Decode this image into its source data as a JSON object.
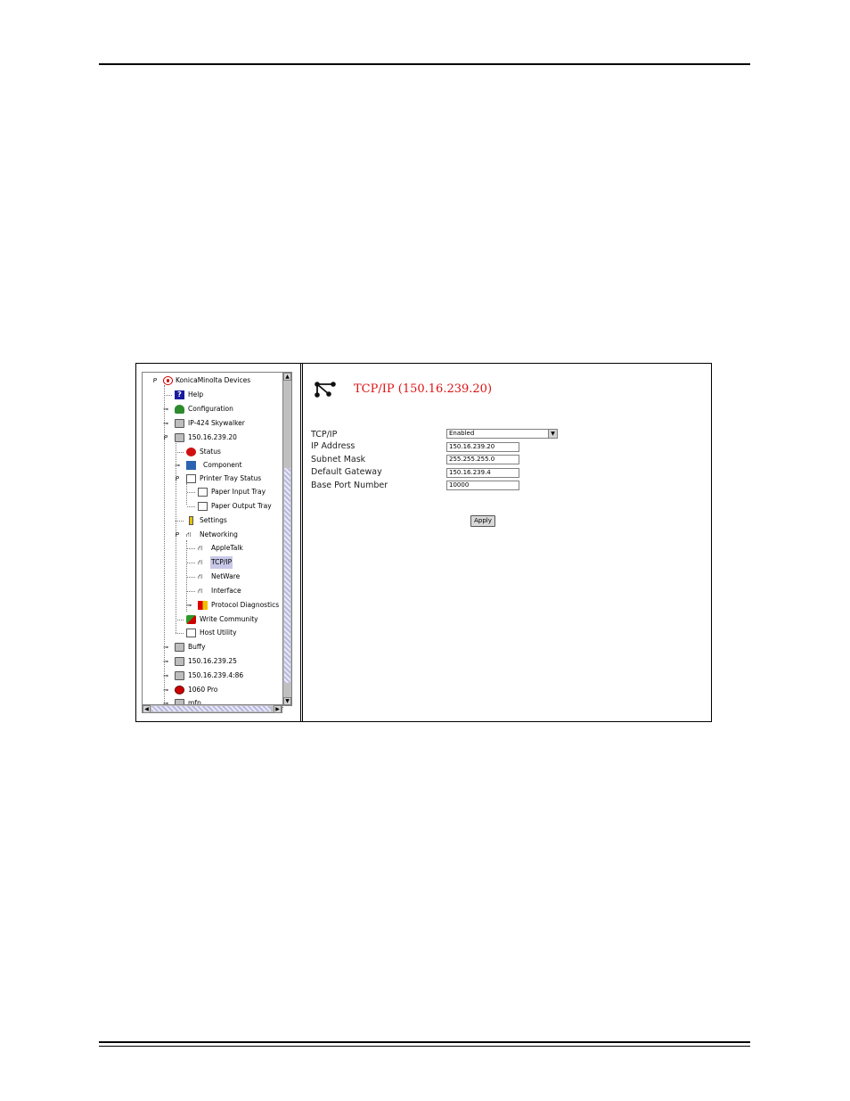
{
  "tree": {
    "root": "KonicaMinolta Devices",
    "items": {
      "help": "Help",
      "configuration": "Configuration",
      "ip424": "IP-424 Skywalker",
      "dev20": "150.16.239.20",
      "status": "Status",
      "component": "Component",
      "tray_status": "Printer Tray Status",
      "paper_input": "Paper Input Tray",
      "paper_output": "Paper Output Tray",
      "settings": "Settings",
      "networking": "Networking",
      "appletalk": "AppleTalk",
      "tcpip": "TCP/IP",
      "netware": "NetWare",
      "interface": "Interface",
      "protocol_diag": "Protocol Diagnostics",
      "write_community": "Write Community",
      "host_utility": "Host Utility",
      "buffy": "Buffy",
      "dev25": "150.16.239.25",
      "dev486": "150.16.239.4:86",
      "pro1060": "1060 Pro",
      "mfp": "mfp"
    }
  },
  "panel": {
    "title": "TCP/IP (150.16.239.20)",
    "fields": {
      "tcpip_label": "TCP/IP",
      "tcpip_value": "Enabled",
      "ip_label": "IP Address",
      "ip_value": "150.16.239.20",
      "mask_label": "Subnet Mask",
      "mask_value": "255.255.255.0",
      "gateway_label": "Default Gateway",
      "gateway_value": "150.16.239.4",
      "port_label": "Base Port Number",
      "port_value": "10000"
    },
    "apply_label": "Apply"
  },
  "icons": [
    "network-icon",
    "printer-icon",
    "help-icon",
    "eye-icon"
  ],
  "colors": {
    "title": "#dd1111",
    "selection": "#c8c8e8"
  }
}
